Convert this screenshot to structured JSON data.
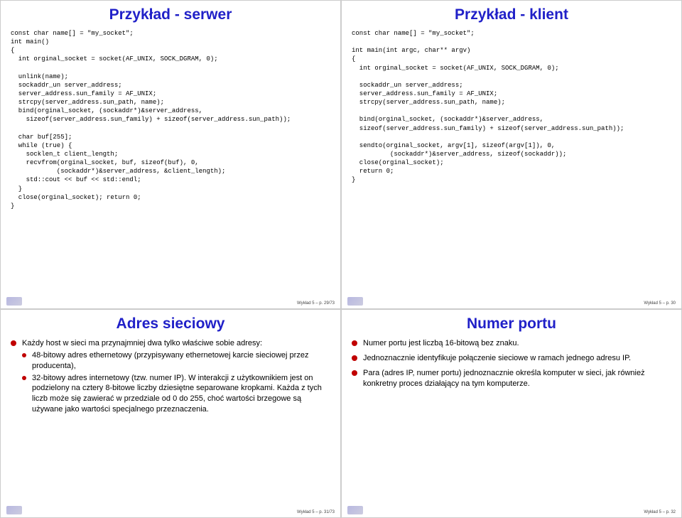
{
  "slides": {
    "topLeft": {
      "title": "Przykład - serwer",
      "code": "const char name[] = \"my_socket\";\nint main()\n{\n  int orginal_socket = socket(AF_UNIX, SOCK_DGRAM, 0);\n\n  unlink(name);\n  sockaddr_un server_address;\n  server_address.sun_family = AF_UNIX;\n  strcpy(server_address.sun_path, name);\n  bind(orginal_socket, (sockaddr*)&server_address,\n    sizeof(server_address.sun_family) + sizeof(server_address.sun_path));\n\n  char buf[255];\n  while (true) {\n    socklen_t client_length;\n    recvfrom(orginal_socket, buf, sizeof(buf), 0,\n            (sockaddr*)&server_address, &client_length);\n    std::cout << buf << std::endl;\n  }\n  close(orginal_socket); return 0;\n}",
      "page": "Wykład 5 – p. 29/73"
    },
    "topRight": {
      "title": "Przykład - klient",
      "code": "const char name[] = \"my_socket\";\n\nint main(int argc, char** argv)\n{\n  int orginal_socket = socket(AF_UNIX, SOCK_DGRAM, 0);\n\n  sockaddr_un server_address;\n  server_address.sun_family = AF_UNIX;\n  strcpy(server_address.sun_path, name);\n\n  bind(orginal_socket, (sockaddr*)&server_address,\n  sizeof(server_address.sun_family) + sizeof(server_address.sun_path));\n\n  sendto(orginal_socket, argv[1], sizeof(argv[1]), 0,\n          (sockaddr*)&server_address, sizeof(sockaddr));\n  close(orginal_socket);\n  return 0;\n}",
      "page": "Wykład 5 – p. 30"
    },
    "bottomLeft": {
      "title": "Adres sieciowy",
      "b1": "Każdy host w sieci ma przynajmniej dwa tylko właściwe sobie adresy:",
      "b1a": "48-bitowy adres ethernetowy (przypisywany ethernetowej karcie sieciowej przez producenta),",
      "b1b": "32-bitowy adres internetowy (tzw. numer IP). W interakcji z użytkownikiem jest on podzielony na cztery 8-bitowe liczby dziesiętne separowane kropkami. Każda z tych liczb może się zawierać w przedziale od 0 do 255, choć wartości brzegowe są używane jako wartości specjalnego przeznaczenia.",
      "page": "Wykład 5 – p. 31/73"
    },
    "bottomRight": {
      "title": "Numer portu",
      "b1": "Numer portu jest liczbą 16-bitową bez znaku.",
      "b2": "Jednoznacznie identyfikuje połączenie sieciowe w ramach jednego adresu IP.",
      "b3": "Para (adres IP, numer portu) jednoznacznie określa komputer w sieci, jak również konkretny proces działający na tym komputerze.",
      "page": "Wykład 5 – p. 32"
    }
  }
}
